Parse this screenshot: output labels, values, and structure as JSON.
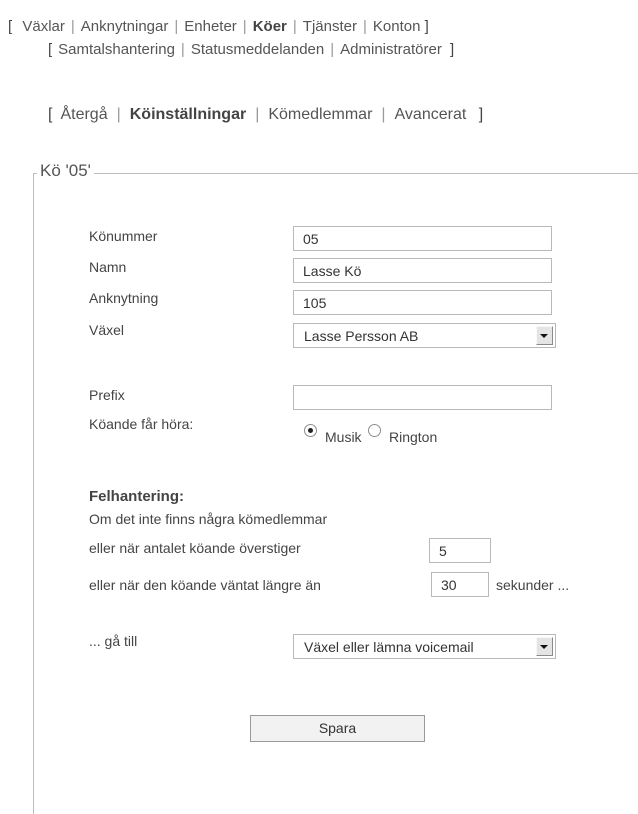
{
  "nav": {
    "open_bracket": "[",
    "close_bracket": "]",
    "separator": "|",
    "items": [
      "Växlar",
      "Anknytningar",
      "Enheter",
      "Köer",
      "Tjänster",
      "Konton"
    ],
    "active": "Köer",
    "sub_items": [
      "Samtalshantering",
      "Statusmeddelanden",
      "Administratörer"
    ]
  },
  "queue_nav": {
    "back": "Återgå",
    "settings": "Köinställningar",
    "members": "Kömedlemmar",
    "advanced": "Avancerat",
    "active": "Köinställningar"
  },
  "legend": "Kö '05'",
  "form": {
    "queue_number": {
      "label": "Könummer",
      "value": "05"
    },
    "name": {
      "label": "Namn",
      "value": "Lasse Kö"
    },
    "extension": {
      "label": "Anknytning",
      "value": "105"
    },
    "exchange": {
      "label": "Växel",
      "value": "Lasse Persson AB"
    },
    "prefix": {
      "label": "Prefix",
      "value": ""
    },
    "hears": {
      "label": "Köande får höra:",
      "options": [
        "Musik",
        "Rington"
      ],
      "selected": "Musik"
    }
  },
  "error_handling": {
    "heading": "Felhantering:",
    "line1": "Om det inte finns några kömedlemmar",
    "line2": "eller när antalet köande överstiger",
    "max_callers": "5",
    "line3": "eller när den köande väntat längre än",
    "max_wait": "30",
    "unit": "sekunder ...",
    "goto_label": "... gå till",
    "goto_value": "Växel eller lämna voicemail"
  },
  "save_button": "Spara"
}
